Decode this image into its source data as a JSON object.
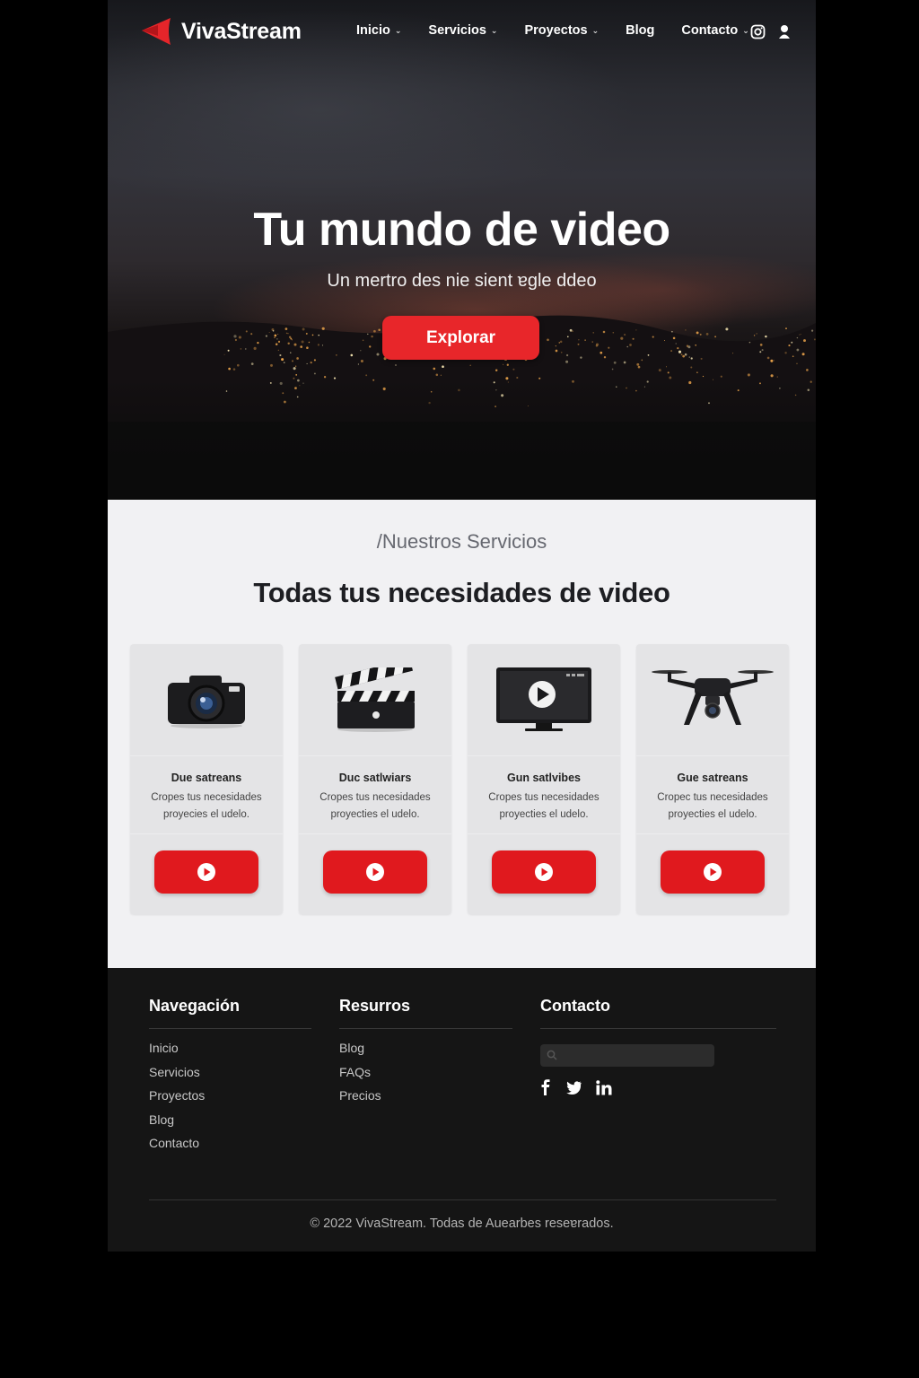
{
  "colors": {
    "accent": "#e0191e",
    "hero_button": "#e8262a",
    "services_bg": "#f1f1f3",
    "footer_bg": "#151515"
  },
  "brand": {
    "name": "VivaStream",
    "logo_icon": "play-arrow-logo-icon"
  },
  "nav": {
    "items": [
      {
        "label": "Inicio",
        "has_dropdown": true
      },
      {
        "label": "Servicios",
        "has_dropdown": true
      },
      {
        "label": "Proyectos",
        "has_dropdown": true
      },
      {
        "label": "Blog",
        "has_dropdown": false
      },
      {
        "label": "Contacto",
        "has_dropdown": true
      }
    ],
    "social_icons": [
      "instagram-icon",
      "user-icon"
    ]
  },
  "hero": {
    "title": "Tu mundo de video",
    "subtitle": "Un mertro des nie sient ɐgle ddeo",
    "button_label": "Explorar"
  },
  "services": {
    "eyebrow": "/Nuestros Servicios",
    "title": "Todas tus necesidades de video",
    "cards": [
      {
        "icon": "camera-icon",
        "title": "Due satreans",
        "desc_line1": "Cropes tus necesidades",
        "desc_line2": "proyecies el udelo.",
        "button_icon": "play-circle-icon"
      },
      {
        "icon": "clapperboard-icon",
        "title": "Duc satlwiars",
        "desc_line1": "Cropes tus necesidades",
        "desc_line2": "proyecties el udelo.",
        "button_icon": "play-circle-icon"
      },
      {
        "icon": "monitor-play-icon",
        "title": "Gun satlvibes",
        "desc_line1": "Cropes tus necesidades",
        "desc_line2": "proyecties el udelo.",
        "button_icon": "play-circle-icon"
      },
      {
        "icon": "drone-icon",
        "title": "Gue satreans",
        "desc_line1": "Cropec tus necesidades",
        "desc_line2": "proyecties el udelo.",
        "button_icon": "play-circle-icon"
      }
    ]
  },
  "footer": {
    "nav_heading": "Navegación",
    "nav_links": [
      "Inicio",
      "Servicios",
      "Proyectos",
      "Blog",
      "Contacto"
    ],
    "resources_heading": "Resurros",
    "resources_links": [
      "Blog",
      "FAQs",
      "Precios"
    ],
    "contact_heading": "Contacto",
    "search_placeholder": "",
    "social_icons": [
      "facebook-icon",
      "twitter-icon",
      "linkedin-icon"
    ],
    "copyright": "© 2022 VivaStream. Todas de Auearbes reseɐrados."
  }
}
